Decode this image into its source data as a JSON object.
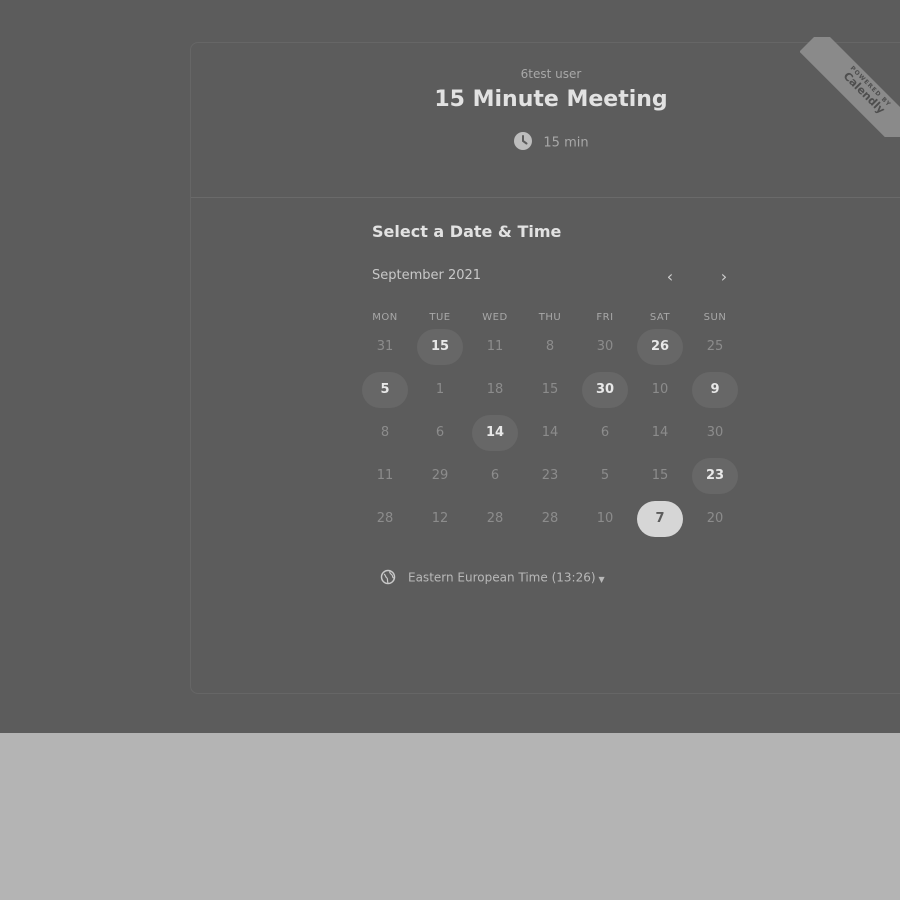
{
  "event": {
    "owner": "6test user",
    "title": "15 Minute Meeting",
    "duration": "15 min"
  },
  "ribbon": {
    "small": "POWERED BY",
    "brand": "Calendly"
  },
  "calendar": {
    "heading": "Select a Date & Time",
    "month": "September 2021",
    "prev_label": "‹",
    "next_label": "›",
    "weekdays": [
      "MON",
      "TUE",
      "WED",
      "THU",
      "FRI",
      "SAT",
      "SUN"
    ],
    "weeks": [
      [
        {
          "d": "31",
          "s": "off"
        },
        {
          "d": "15",
          "s": "avail"
        },
        {
          "d": "11",
          "s": "off"
        },
        {
          "d": "8",
          "s": "off"
        },
        {
          "d": "30",
          "s": "off"
        },
        {
          "d": "26",
          "s": "avail"
        },
        {
          "d": "25",
          "s": "off"
        }
      ],
      [
        {
          "d": "5",
          "s": "avail"
        },
        {
          "d": "1",
          "s": "off"
        },
        {
          "d": "18",
          "s": "off"
        },
        {
          "d": "15",
          "s": "off"
        },
        {
          "d": "30",
          "s": "avail"
        },
        {
          "d": "10",
          "s": "off"
        },
        {
          "d": "9",
          "s": "avail"
        }
      ],
      [
        {
          "d": "8",
          "s": "off"
        },
        {
          "d": "6",
          "s": "off"
        },
        {
          "d": "14",
          "s": "avail"
        },
        {
          "d": "14",
          "s": "off"
        },
        {
          "d": "6",
          "s": "off"
        },
        {
          "d": "14",
          "s": "off"
        },
        {
          "d": "30",
          "s": "off"
        }
      ],
      [
        {
          "d": "11",
          "s": "off"
        },
        {
          "d": "29",
          "s": "off"
        },
        {
          "d": "6",
          "s": "off"
        },
        {
          "d": "23",
          "s": "off"
        },
        {
          "d": "5",
          "s": "off"
        },
        {
          "d": "15",
          "s": "off"
        },
        {
          "d": "23",
          "s": "avail"
        }
      ],
      [
        {
          "d": "28",
          "s": "off"
        },
        {
          "d": "12",
          "s": "off"
        },
        {
          "d": "28",
          "s": "off"
        },
        {
          "d": "28",
          "s": "off"
        },
        {
          "d": "10",
          "s": "off"
        },
        {
          "d": "7",
          "s": "selected"
        },
        {
          "d": "20",
          "s": "off"
        }
      ]
    ]
  },
  "timezone": {
    "label": "Eastern European Time (13:26)",
    "caret": "▼"
  },
  "colors": {
    "overlay": "#5c5c5c",
    "page": "#b4b4b4",
    "selected": "#d6d6d6"
  }
}
